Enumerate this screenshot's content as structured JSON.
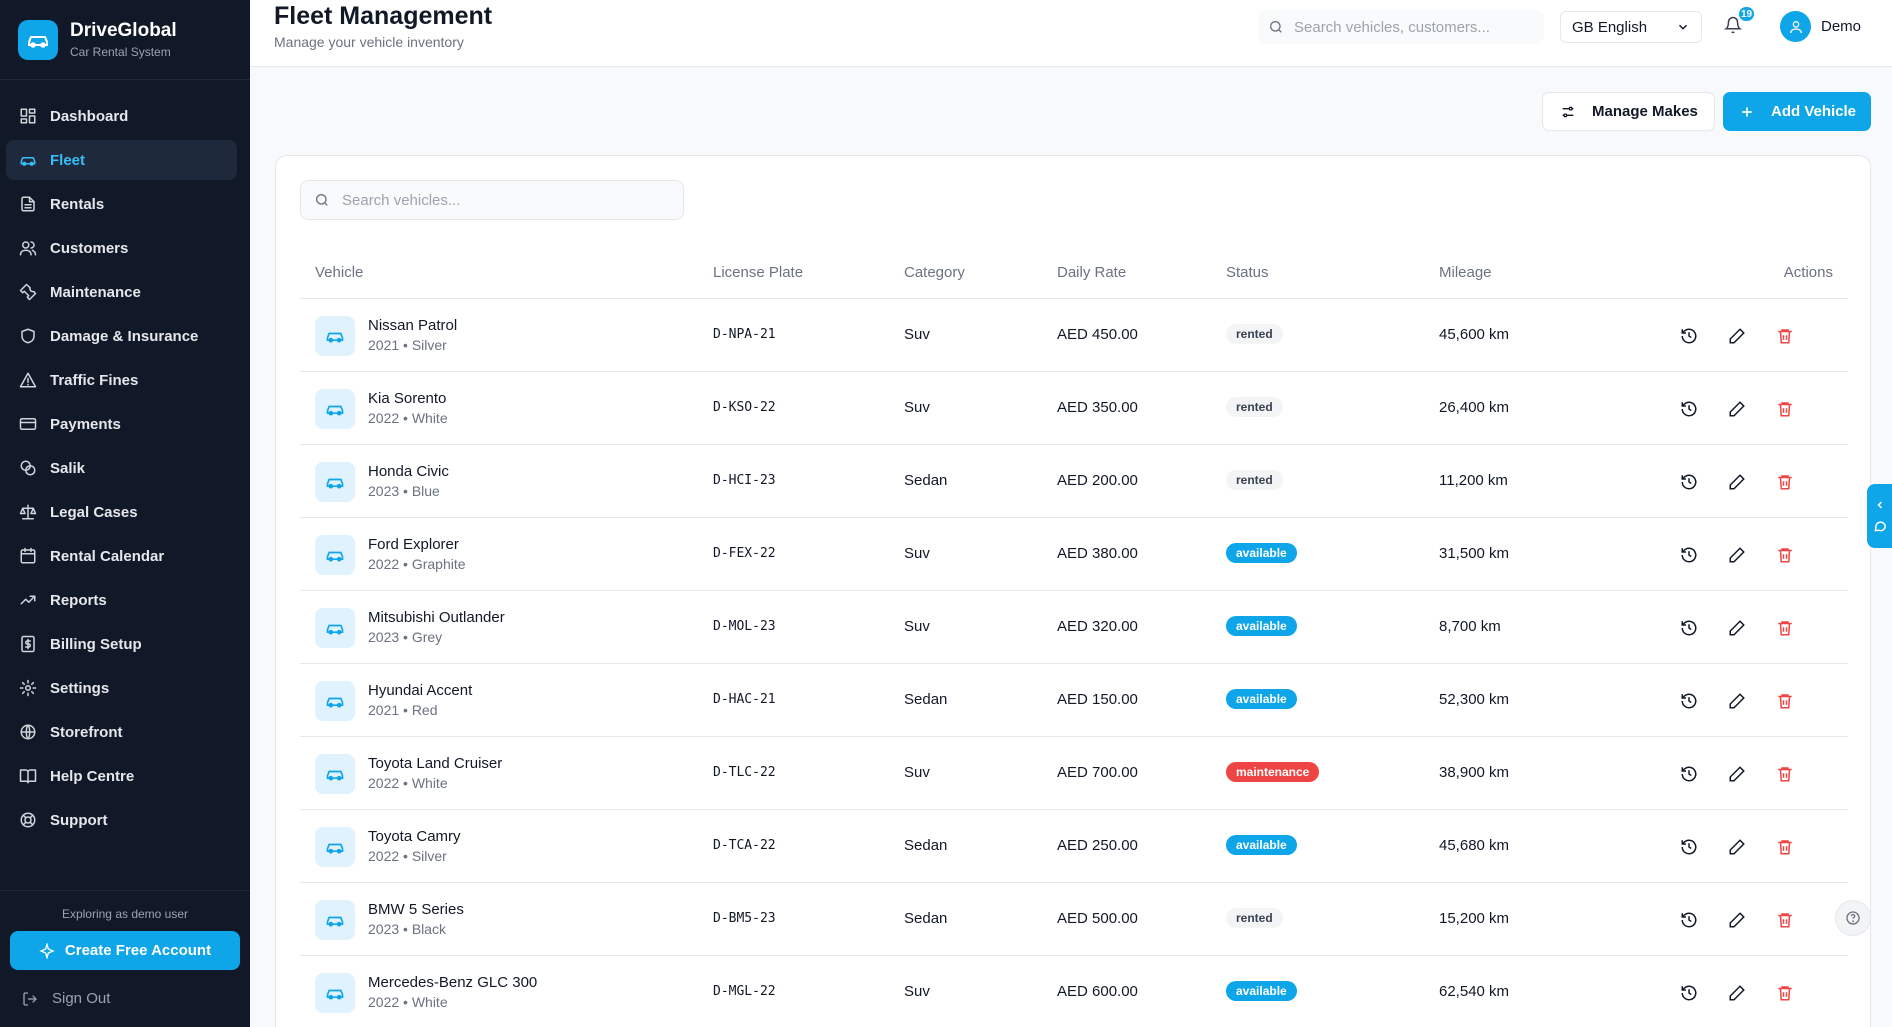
{
  "brand": {
    "name": "DriveGlobal",
    "subtitle": "Car Rental System"
  },
  "sidebar": {
    "items": [
      {
        "label": "Dashboard",
        "icon": "dashboard-icon",
        "active": false
      },
      {
        "label": "Fleet",
        "icon": "car-icon",
        "active": true
      },
      {
        "label": "Rentals",
        "icon": "document-icon",
        "active": false
      },
      {
        "label": "Customers",
        "icon": "users-icon",
        "active": false
      },
      {
        "label": "Maintenance",
        "icon": "wrench-icon",
        "active": false
      },
      {
        "label": "Damage & Insurance",
        "icon": "shield-icon",
        "active": false
      },
      {
        "label": "Traffic Fines",
        "icon": "warning-icon",
        "active": false
      },
      {
        "label": "Payments",
        "icon": "credit-card-icon",
        "active": false
      },
      {
        "label": "Salik",
        "icon": "toll-icon",
        "active": false
      },
      {
        "label": "Legal Cases",
        "icon": "scale-icon",
        "active": false
      },
      {
        "label": "Rental Calendar",
        "icon": "calendar-icon",
        "active": false
      },
      {
        "label": "Reports",
        "icon": "trend-icon",
        "active": false
      },
      {
        "label": "Billing Setup",
        "icon": "billing-icon",
        "active": false
      },
      {
        "label": "Settings",
        "icon": "gear-icon",
        "active": false
      },
      {
        "label": "Storefront",
        "icon": "globe-icon",
        "active": false
      },
      {
        "label": "Help Centre",
        "icon": "book-icon",
        "active": false
      },
      {
        "label": "Support",
        "icon": "lifebuoy-icon",
        "active": false
      }
    ],
    "demo_note": "Exploring as demo user",
    "create_account": "Create Free Account",
    "sign_out": "Sign Out"
  },
  "header": {
    "title": "Fleet Management",
    "subtitle": "Manage your vehicle inventory",
    "search_placeholder": "Search vehicles, customers...",
    "language": "GB English",
    "notifications": "19",
    "user": "Demo"
  },
  "actions": {
    "manage_makes": "Manage Makes",
    "add_vehicle": "Add Vehicle"
  },
  "table": {
    "search_placeholder": "Search vehicles...",
    "columns": [
      "Vehicle",
      "License Plate",
      "Category",
      "Daily Rate",
      "Status",
      "Mileage",
      "Actions"
    ],
    "rows": [
      {
        "name": "Nissan Patrol",
        "meta": "2021 • Silver",
        "plate": "D-NPA-21",
        "category": "Suv",
        "rate": "AED 450.00",
        "status": "rented",
        "mileage": "45,600 km"
      },
      {
        "name": "Kia Sorento",
        "meta": "2022 • White",
        "plate": "D-KSO-22",
        "category": "Suv",
        "rate": "AED 350.00",
        "status": "rented",
        "mileage": "26,400 km"
      },
      {
        "name": "Honda Civic",
        "meta": "2023 • Blue",
        "plate": "D-HCI-23",
        "category": "Sedan",
        "rate": "AED 200.00",
        "status": "rented",
        "mileage": "11,200 km"
      },
      {
        "name": "Ford Explorer",
        "meta": "2022 • Graphite",
        "plate": "D-FEX-22",
        "category": "Suv",
        "rate": "AED 380.00",
        "status": "available",
        "mileage": "31,500 km"
      },
      {
        "name": "Mitsubishi Outlander",
        "meta": "2023 • Grey",
        "plate": "D-MOL-23",
        "category": "Suv",
        "rate": "AED 320.00",
        "status": "available",
        "mileage": "8,700 km"
      },
      {
        "name": "Hyundai Accent",
        "meta": "2021 • Red",
        "plate": "D-HAC-21",
        "category": "Sedan",
        "rate": "AED 150.00",
        "status": "available",
        "mileage": "52,300 km"
      },
      {
        "name": "Toyota Land Cruiser",
        "meta": "2022 • White",
        "plate": "D-TLC-22",
        "category": "Suv",
        "rate": "AED 700.00",
        "status": "maintenance",
        "mileage": "38,900 km"
      },
      {
        "name": "Toyota Camry",
        "meta": "2022 • Silver",
        "plate": "D-TCA-22",
        "category": "Sedan",
        "rate": "AED 250.00",
        "status": "available",
        "mileage": "45,680 km"
      },
      {
        "name": "BMW 5 Series",
        "meta": "2023 • Black",
        "plate": "D-BM5-23",
        "category": "Sedan",
        "rate": "AED 500.00",
        "status": "rented",
        "mileage": "15,200 km"
      },
      {
        "name": "Mercedes-Benz GLC 300",
        "meta": "2022 • White",
        "plate": "D-MGL-22",
        "category": "Suv",
        "rate": "AED 600.00",
        "status": "available",
        "mileage": "62,540 km"
      }
    ]
  },
  "colors": {
    "accent": "#0ea5e9",
    "danger": "#ef4444",
    "sidebar_bg": "#111827"
  }
}
